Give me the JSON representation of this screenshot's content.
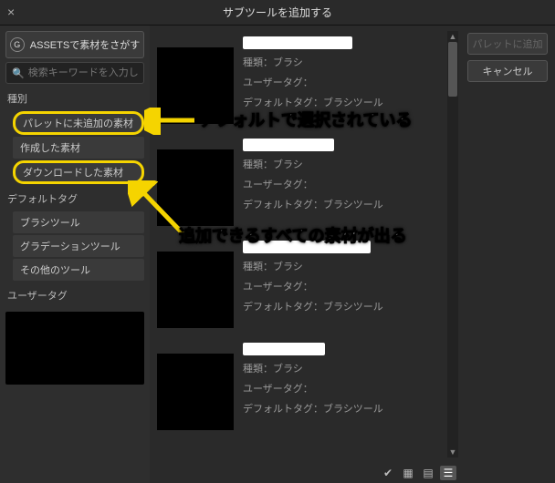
{
  "title": "サブツールを追加する",
  "sidebar": {
    "assets_button": "ASSETSで素材をさがす",
    "search_placeholder": "検索キーワードを入力し…",
    "section_type": "種別",
    "items": [
      {
        "label": "パレットに未追加の素材"
      },
      {
        "label": "作成した素材"
      },
      {
        "label": "ダウンロードした素材"
      }
    ],
    "section_default_tag": "デフォルトタグ",
    "tags": [
      {
        "label": "ブラシツール"
      },
      {
        "label": "グラデーションツール"
      },
      {
        "label": "その他のツール"
      }
    ],
    "section_user_tag": "ユーザータグ"
  },
  "list": {
    "meta": {
      "type_label": "種類：",
      "type_value": "ブラシ",
      "usertag_label": "ユーザータグ：",
      "defaulttag_label": "デフォルトタグ：",
      "defaulttag_value": "ブラシツール"
    }
  },
  "right": {
    "add": "パレットに追加",
    "cancel": "キャンセル"
  },
  "annotations": {
    "a1": "デフォルトで選択されている",
    "a2": "追加できるすべての素材が出る"
  }
}
